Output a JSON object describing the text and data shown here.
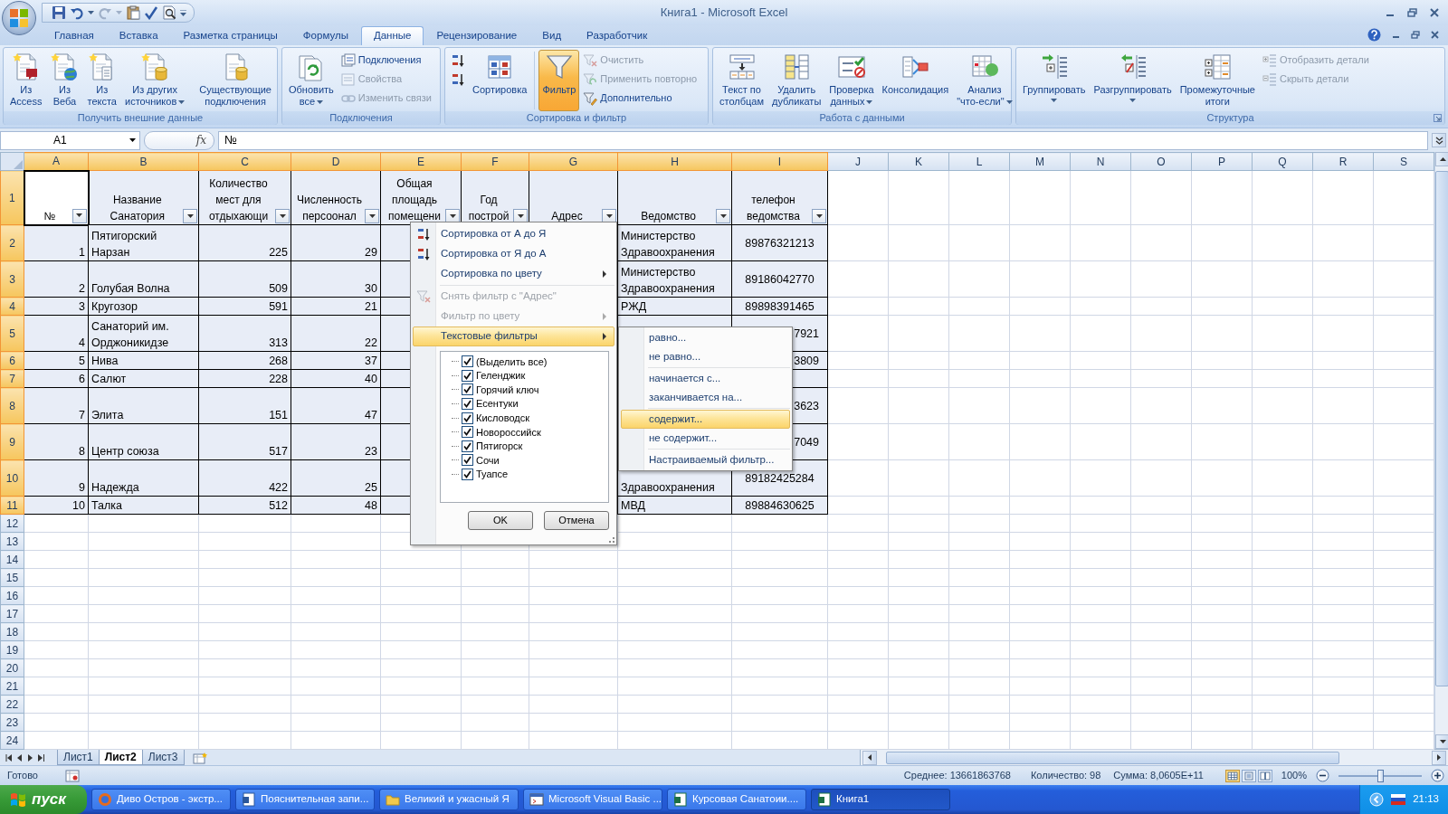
{
  "title_bar": {
    "title": "Книга1 - Microsoft Excel"
  },
  "ribbon_tabs": [
    {
      "label": "Главная",
      "selected": false
    },
    {
      "label": "Вставка",
      "selected": false
    },
    {
      "label": "Разметка страницы",
      "selected": false
    },
    {
      "label": "Формулы",
      "selected": false
    },
    {
      "label": "Данные",
      "selected": true
    },
    {
      "label": "Рецензирование",
      "selected": false
    },
    {
      "label": "Вид",
      "selected": false
    },
    {
      "label": "Разработчик",
      "selected": false
    }
  ],
  "ribbon_groups": [
    {
      "label": "Получить внешние данные",
      "launcher": false,
      "controls": [
        {
          "kind": "large",
          "label": "Из\nAccess",
          "dropdown": false,
          "on": false
        },
        {
          "kind": "large",
          "label": "Из\nВеба",
          "dropdown": false,
          "on": false
        },
        {
          "kind": "large",
          "label": "Из\nтекста",
          "dropdown": false,
          "on": false
        },
        {
          "kind": "large",
          "label": "Из других\nисточников",
          "dropdown": true,
          "on": false
        },
        {
          "kind": "divider"
        },
        {
          "kind": "large",
          "label": "Существующие\nподключения",
          "dropdown": false,
          "on": false
        }
      ]
    },
    {
      "label": "Подключения",
      "launcher": false,
      "controls": [
        {
          "kind": "large",
          "label": "Обновить\nвсе",
          "dropdown": true,
          "on": false
        },
        {
          "kind": "stack",
          "items": [
            {
              "label": "Подключения",
              "disabled": false
            },
            {
              "label": "Свойства",
              "disabled": true
            },
            {
              "label": "Изменить связи",
              "disabled": true
            }
          ]
        }
      ]
    },
    {
      "label": "Сортировка и фильтр",
      "launcher": false,
      "controls": [
        {
          "kind": "stack",
          "items": [
            {
              "disabled": false
            },
            {
              "disabled": false
            }
          ]
        },
        {
          "kind": "large",
          "label": "Сортировка",
          "dropdown": false,
          "on": false
        },
        {
          "kind": "divider"
        },
        {
          "kind": "large",
          "label": "Фильтр",
          "dropdown": false,
          "on": true
        },
        {
          "kind": "stack",
          "items": [
            {
              "label": "Очистить",
              "disabled": true
            },
            {
              "label": "Применить повторно",
              "disabled": true
            },
            {
              "label": "Дополнительно",
              "disabled": false
            }
          ]
        }
      ]
    },
    {
      "label": "Работа с данными",
      "launcher": false,
      "controls": [
        {
          "kind": "large",
          "label": "Текст по\nстолбцам",
          "dropdown": false,
          "on": false
        },
        {
          "kind": "large",
          "label": "Удалить\nдубликаты",
          "dropdown": false,
          "on": false
        },
        {
          "kind": "large",
          "label": "Проверка\nданных",
          "dropdown": true,
          "on": false
        },
        {
          "kind": "large",
          "label": "Консолидация",
          "dropdown": false,
          "on": false
        },
        {
          "kind": "large",
          "label": "Анализ\n\"что-если\"",
          "dropdown": true,
          "on": false
        }
      ]
    },
    {
      "label": "Структура",
      "launcher": true,
      "controls": [
        {
          "kind": "large",
          "label": "Группировать",
          "dropdown": true,
          "on": false
        },
        {
          "kind": "large",
          "label": "Разгруппировать",
          "dropdown": true,
          "on": false
        },
        {
          "kind": "large",
          "label": "Промежуточные\nитоги",
          "dropdown": false,
          "on": false
        },
        {
          "kind": "stack",
          "items": [
            {
              "label": "Отобразить детали",
              "disabled": true
            },
            {
              "label": "Скрыть детали",
              "disabled": true
            }
          ]
        }
      ]
    }
  ],
  "formula_bar": {
    "name_box": "A1",
    "function_label": "fx",
    "formula": "№"
  },
  "columns": [
    {
      "label": "A",
      "selected": true
    },
    {
      "label": "B",
      "selected": true
    },
    {
      "label": "C",
      "selected": true
    },
    {
      "label": "D",
      "selected": true
    },
    {
      "label": "E",
      "selected": true
    },
    {
      "label": "F",
      "selected": true
    },
    {
      "label": "G",
      "selected": true
    },
    {
      "label": "H",
      "selected": true
    },
    {
      "label": "I",
      "selected": true
    },
    {
      "label": "J",
      "selected": false
    },
    {
      "label": "K",
      "selected": false
    },
    {
      "label": "L",
      "selected": false
    },
    {
      "label": "M",
      "selected": false
    },
    {
      "label": "N",
      "selected": false
    },
    {
      "label": "O",
      "selected": false
    },
    {
      "label": "P",
      "selected": false
    },
    {
      "label": "Q",
      "selected": false
    },
    {
      "label": "R",
      "selected": false
    },
    {
      "label": "S",
      "selected": false
    }
  ],
  "row_headers": [
    {
      "label": "1",
      "selected": true
    },
    {
      "label": "2",
      "selected": true
    },
    {
      "label": "3",
      "selected": true
    },
    {
      "label": "4",
      "selected": true
    },
    {
      "label": "5",
      "selected": true
    },
    {
      "label": "6",
      "selected": true
    },
    {
      "label": "7",
      "selected": true
    },
    {
      "label": "8",
      "selected": true
    },
    {
      "label": "9",
      "selected": true
    },
    {
      "label": "10",
      "selected": true
    },
    {
      "label": "11",
      "selected": true
    },
    {
      "label": "12",
      "selected": false
    },
    {
      "label": "13",
      "selected": false
    },
    {
      "label": "14",
      "selected": false
    },
    {
      "label": "15",
      "selected": false
    },
    {
      "label": "16",
      "selected": false
    },
    {
      "label": "17",
      "selected": false
    },
    {
      "label": "18",
      "selected": false
    },
    {
      "label": "19",
      "selected": false
    },
    {
      "label": "20",
      "selected": false
    },
    {
      "label": "21",
      "selected": false
    },
    {
      "label": "22",
      "selected": false
    },
    {
      "label": "23",
      "selected": false
    },
    {
      "label": "24",
      "selected": false
    }
  ],
  "table": {
    "header_cells": [
      "№",
      "Название\nСанатория",
      "Количество\nмест для\nотдыхающи",
      "Численность\nперсоонал",
      "Общая\nплощадь\nпомещени",
      "Год\nпострой",
      "Адрес",
      "Ведомство",
      "телефон\nведомства"
    ],
    "rows": [
      {
        "number": "1",
        "name": "Пятигорский\nНарзан",
        "places": "225",
        "staff": "29",
        "agency": "Министерство\nЗдравоохранения",
        "phone": "89876321213"
      },
      {
        "number": "2",
        "name": "Голубая Волна",
        "places": "509",
        "staff": "30",
        "agency": "Министерство\nЗдравоохранения",
        "phone": "89186042770"
      },
      {
        "number": "3",
        "name": "Кругозор",
        "places": "591",
        "staff": "21",
        "agency": "РЖД",
        "phone": "89898391465"
      },
      {
        "number": "4",
        "name": "Санаторий им.\nОрджоникидзе",
        "places": "313",
        "staff": "22",
        "phone": "7921"
      },
      {
        "number": "5",
        "name": "Нива",
        "places": "268",
        "staff": "37",
        "phone": "3809"
      },
      {
        "number": "6",
        "name": "Салют",
        "places": "228",
        "staff": "40"
      },
      {
        "number": "7",
        "name": "Элита",
        "places": "151",
        "staff": "47",
        "phone": "3623"
      },
      {
        "number": "8",
        "name": "Центр союза",
        "places": "517",
        "staff": "23",
        "phone": "7049"
      },
      {
        "number": "9",
        "name": "Надежда",
        "places": "422",
        "staff": "25",
        "agency": "Здравоохранения",
        "phone": "89182425284"
      },
      {
        "number": "10",
        "name": "Талка",
        "places": "512",
        "staff": "48",
        "agency": "МВД",
        "phone": "89884630625"
      }
    ]
  },
  "filter_menu": {
    "items": [
      {
        "kind": "item",
        "label": "Сортировка от А до Я",
        "disabled": false,
        "submenu": false,
        "selected": false
      },
      {
        "kind": "item",
        "label": "Сортировка от Я до А",
        "disabled": false,
        "submenu": false,
        "selected": false
      },
      {
        "kind": "item",
        "label": "Сортировка по цвету",
        "disabled": false,
        "submenu": true,
        "selected": false
      },
      {
        "kind": "separator"
      },
      {
        "kind": "item",
        "label": "Снять фильтр с \"Адрес\"",
        "disabled": true,
        "submenu": false,
        "selected": false
      },
      {
        "kind": "item",
        "label": "Фильтр по цвету",
        "disabled": true,
        "submenu": true,
        "selected": false
      },
      {
        "kind": "item",
        "label": "Текстовые фильтры",
        "disabled": false,
        "submenu": true,
        "selected": true
      }
    ],
    "values": [
      {
        "label": "(Выделить все)",
        "checked": true
      },
      {
        "label": "Геленджик",
        "checked": true
      },
      {
        "label": "Горячий ключ",
        "checked": true
      },
      {
        "label": "Есентуки",
        "checked": true
      },
      {
        "label": "Кисловодск",
        "checked": true
      },
      {
        "label": "Новороссийск",
        "checked": true
      },
      {
        "label": "Пятигорск",
        "checked": true
      },
      {
        "label": "Сочи",
        "checked": true
      },
      {
        "label": "Туапсе",
        "checked": true
      }
    ],
    "buttons": [
      "OK",
      "Отмена"
    ]
  },
  "text_filters_menu": {
    "items": [
      {
        "kind": "item",
        "label": "равно...",
        "selected": false
      },
      {
        "kind": "item",
        "label": "не равно...",
        "selected": false
      },
      {
        "kind": "separator"
      },
      {
        "kind": "item",
        "label": "начинается с...",
        "selected": false
      },
      {
        "kind": "item",
        "label": "заканчивается на...",
        "selected": false
      },
      {
        "kind": "separator"
      },
      {
        "kind": "item",
        "label": "содержит...",
        "selected": true
      },
      {
        "kind": "item",
        "label": "не содержит...",
        "selected": false
      },
      {
        "kind": "separator"
      },
      {
        "kind": "item",
        "label": "Настраиваемый фильтр...",
        "selected": false
      }
    ]
  },
  "sheet_tabs": [
    {
      "label": "Лист1",
      "selected": false
    },
    {
      "label": "Лист2",
      "selected": true
    },
    {
      "label": "Лист3",
      "selected": false
    }
  ],
  "status_bar": {
    "mode": "Готово",
    "average": "Среднее: 13661863768",
    "count": "Количество: 98",
    "sum": "Сумма: 8,0605E+11",
    "views": [
      {
        "selected": true
      },
      {
        "selected": false
      },
      {
        "selected": false
      }
    ],
    "zoom": "100%",
    "zoom_slider": {
      "level": 0.5
    }
  },
  "taskbar": {
    "start": "пуск",
    "tasks": [
      {
        "label": "Диво Остров - экстр...",
        "selected": false
      },
      {
        "label": "Пояснительная запи...",
        "selected": false
      },
      {
        "label": "Великий и ужасный Я",
        "selected": false
      },
      {
        "label": "Microsoft Visual Basic ...",
        "selected": false
      },
      {
        "label": "Курсовая Санатоии....",
        "selected": false
      },
      {
        "label": "Книга1",
        "selected": true
      }
    ],
    "clock": "21:13"
  }
}
